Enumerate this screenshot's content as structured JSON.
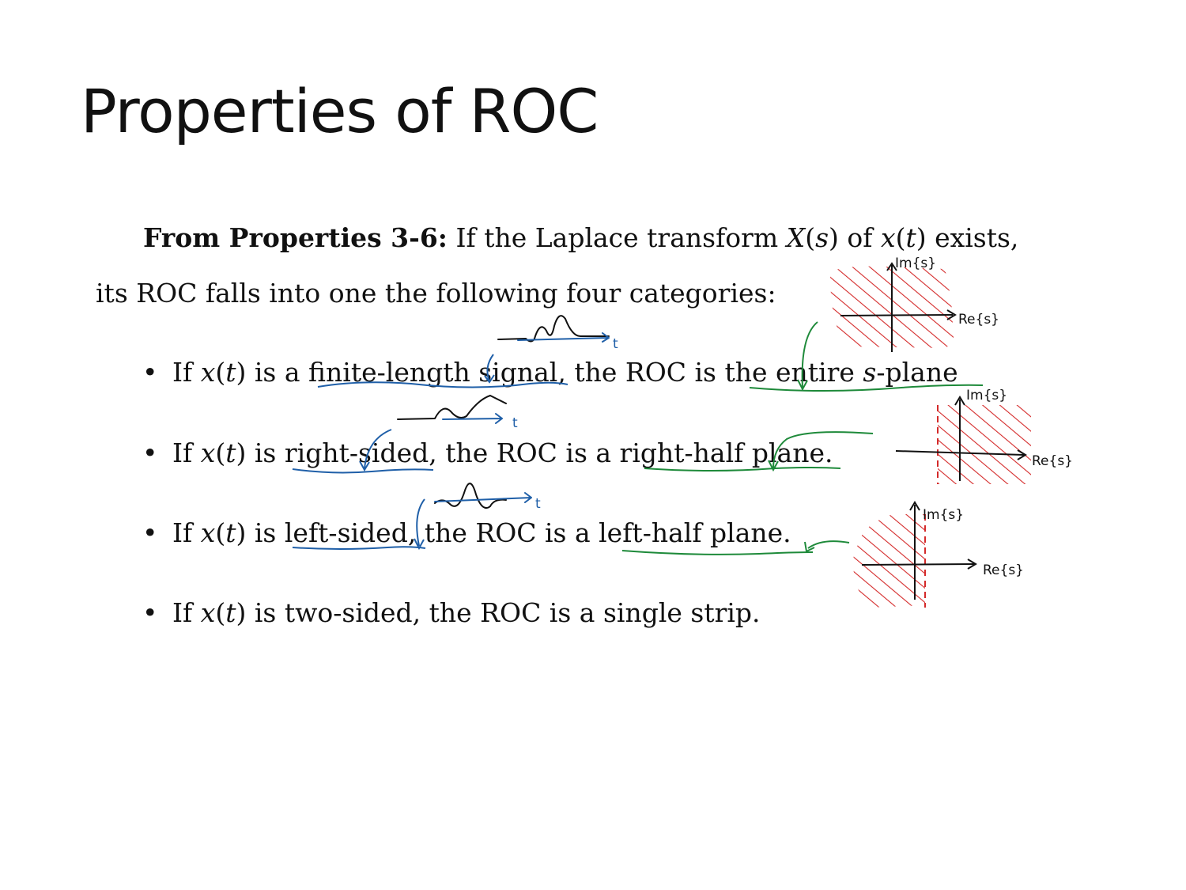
{
  "slide": {
    "title": "Properties of ROC",
    "intro": {
      "bold": "From Properties 3-6:",
      "line1_a": " If the Laplace transform ",
      "X_sym": "X",
      "s_sym": "s",
      "line1_b": " of ",
      "x_sym": "x",
      "t_sym": "t",
      "line1_c": " exists,",
      "line2": "its ROC falls into one the following four categories:"
    },
    "bullets": [
      {
        "pre": "If ",
        "mid": " is a finite-length signal, the ROC is the entire ",
        "math_s": "s",
        "post": "-plane"
      },
      {
        "pre": "If ",
        "mid": " is right-sided, the ROC is a right-half plane.",
        "math_s": "",
        "post": ""
      },
      {
        "pre": "If ",
        "mid": " is left-sided, the ROC is a left-half plane.",
        "math_s": "",
        "post": ""
      },
      {
        "pre": "If ",
        "mid": " is two-sided, the ROC is a single strip.",
        "math_s": "",
        "post": ""
      }
    ],
    "bullet_symbol": "•",
    "math_x": "x",
    "math_t": "t"
  },
  "annotations": {
    "t_label": "t",
    "im_label": "Im{s}",
    "re_label": "Re{s}",
    "colors": {
      "blue": "#1f5fa8",
      "green": "#1e8a3a",
      "red": "#d42a2a",
      "black": "#111111"
    }
  }
}
